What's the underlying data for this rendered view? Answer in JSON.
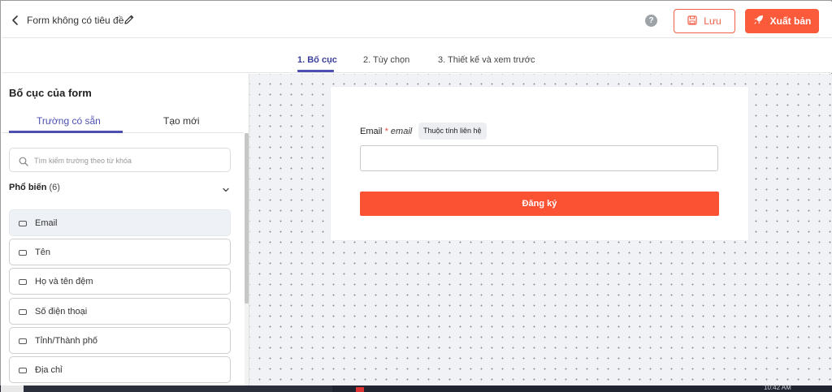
{
  "header": {
    "form_title": "Form không có tiêu đề",
    "help_symbol": "?",
    "save_label": "Lưu",
    "publish_label": "Xuất bản"
  },
  "steps": [
    {
      "label": "1. Bố cục",
      "active": true
    },
    {
      "label": "2. Tùy chọn",
      "active": false
    },
    {
      "label": "3. Thiết kế và xem trước",
      "active": false
    }
  ],
  "sidebar": {
    "title": "Bố cục của form",
    "tabs": [
      {
        "label": "Trường có sẵn",
        "active": true
      },
      {
        "label": "Tạo mới",
        "active": false
      }
    ],
    "search": {
      "placeholder": "Tìm kiếm trường theo từ khóa",
      "value": ""
    },
    "group": {
      "name": "Phổ biến",
      "count": "(6)"
    },
    "fields": [
      {
        "label": "Email",
        "highlighted": true
      },
      {
        "label": "Tên",
        "highlighted": false
      },
      {
        "label": "Họ và tên đệm",
        "highlighted": false
      },
      {
        "label": "Số điện thoại",
        "highlighted": false
      },
      {
        "label": "Tỉnh/Thành phố",
        "highlighted": false
      },
      {
        "label": "Địa chỉ",
        "highlighted": false
      }
    ]
  },
  "form": {
    "email_label": "Email",
    "required_mark": "*",
    "field_key": "email",
    "attribute_badge": "Thuộc tính liên hệ",
    "email_value": "",
    "submit_label": "Đăng ký"
  },
  "taskbar": {
    "time": "10:42 AM"
  },
  "colors": {
    "accent": "#4c4fb0",
    "primary_button": "#fb5a3b",
    "save_border": "#f0604a",
    "canvas_bg": "#f0f2f5"
  }
}
